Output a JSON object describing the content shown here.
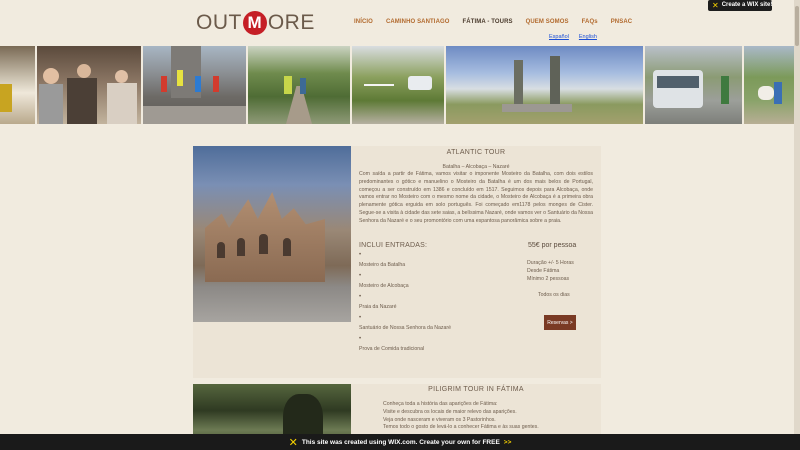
{
  "wix_badge": {
    "text": "Create a WIX site!"
  },
  "header": {
    "logo_left": "OUT",
    "logo_mid": "M",
    "logo_right": "ORE",
    "nav": [
      {
        "label": "INÍCIO",
        "active": false
      },
      {
        "label": "CAMINHO SANTIAGO",
        "active": false
      },
      {
        "label": "FÁTIMA - TOURS",
        "active": true
      },
      {
        "label": "QUEM SOMOS",
        "active": false
      },
      {
        "label": "FAQs",
        "active": false
      },
      {
        "label": "PNSAC",
        "active": false
      }
    ],
    "languages": [
      "Español",
      "English"
    ]
  },
  "gallery": {
    "photo_count": 9
  },
  "tour1": {
    "title": "ATLANTIC TOUR",
    "subtitle": "Batalha – Alcobaça – Nazaré",
    "description": "Com saída a partir de Fátima, vamos visitar o imponente Mosteiro da Batalha, com dois estilos predominantes o gótico e manuelino o Mosteiro da Batalha é um dos mais belos de Portugal, começou a ser construído em 1386 e concluído em 1517. Seguimos depois para Alcobaça, onde vamos entrar no Mosteiro com o mesmo nome da cidade, o Mosteiro de Alcobaça é a primeira obra plenamente gótica erguida em solo português. Foi começado em1178 pelos monges de Cister. Segue-se a visita à cidade das sete saias, a belíssima Nazaré, onde vamos ver o Santuário da Nossa Senhora da Nazaré e o seu promontório com uma espantosa panorâmica sobre a praia.",
    "includes_label": "INCLUI ENTRADAS:",
    "includes": [
      "Mosteiro da Batalha",
      "Mosteiro de Alcobaça",
      "Praia da Nazaré",
      "Santuário de Nossa Senhora da Nazaré",
      "Prova de Comida tradicional"
    ],
    "price": "55€ por pessoa",
    "duration": "Duração +/- 5 Horas",
    "departure": "Desde Fátima",
    "minimum": "Mínimo 2 pessoas",
    "days": "Todos os dias",
    "reserve_label": "Reservas >"
  },
  "tour2": {
    "title": "PILIGRIM TOUR  IN FÁTIMA",
    "lines": [
      "Conheça toda a história das aparições de Fátima:",
      "Visite e descubra os locais de maior relevo das aparições.",
      "Veja onde nasceram e viveram os 3 Pastorinhos.",
      "Temos todo o gosto de levá-lo a conhecer Fátima e às suas gentes."
    ]
  },
  "wix_banner": {
    "text": "This site was created using WIX.com. Create your own for FREE",
    "arrow": ">>"
  },
  "colors": {
    "background": "#f1ebdf",
    "card": "#ece4d6",
    "nav": "#b26a2e",
    "accent": "#c51f26",
    "button": "#7a3a24"
  }
}
